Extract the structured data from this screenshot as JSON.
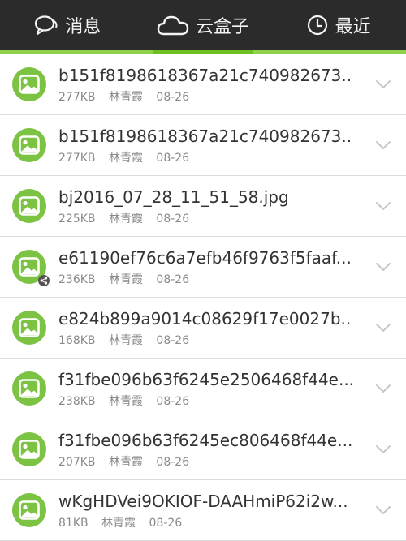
{
  "tabs": [
    {
      "label": "消息",
      "icon": "chat-bubble-icon",
      "active": false
    },
    {
      "label": "云盒子",
      "icon": "cloud-icon",
      "active": true
    },
    {
      "label": "最近",
      "icon": "clock-icon",
      "active": false
    }
  ],
  "colors": {
    "tabbar_bg": "#2b2b2b",
    "accent_green": "#6fbf22",
    "icon_green": "#7cc243"
  },
  "files": [
    {
      "name": "b151f8198618367a21c740982673...",
      "size": "277KB",
      "owner": "林青霞",
      "date": "08-26",
      "shared": false
    },
    {
      "name": "b151f8198618367a21c740982673...",
      "size": "277KB",
      "owner": "林青霞",
      "date": "08-26",
      "shared": false
    },
    {
      "name": "bj2016_07_28_11_51_58.jpg",
      "size": "225KB",
      "owner": "林青霞",
      "date": "08-26",
      "shared": false
    },
    {
      "name": "e61190ef76c6a7efb46f9763f5faaf...",
      "size": "236KB",
      "owner": "林青霞",
      "date": "08-26",
      "shared": true
    },
    {
      "name": "e824b899a9014c08629f17e0027b...",
      "size": "168KB",
      "owner": "林青霞",
      "date": "08-26",
      "shared": false
    },
    {
      "name": "f31fbe096b63f6245e2506468f44e...",
      "size": "238KB",
      "owner": "林青霞",
      "date": "08-26",
      "shared": false
    },
    {
      "name": "f31fbe096b63f6245ec806468f44e...",
      "size": "207KB",
      "owner": "林青霞",
      "date": "08-26",
      "shared": false
    },
    {
      "name": "wKgHDVei9OKIOF-DAAHmiP62i2w...",
      "size": "81KB",
      "owner": "林青霞",
      "date": "08-26",
      "shared": false
    }
  ]
}
